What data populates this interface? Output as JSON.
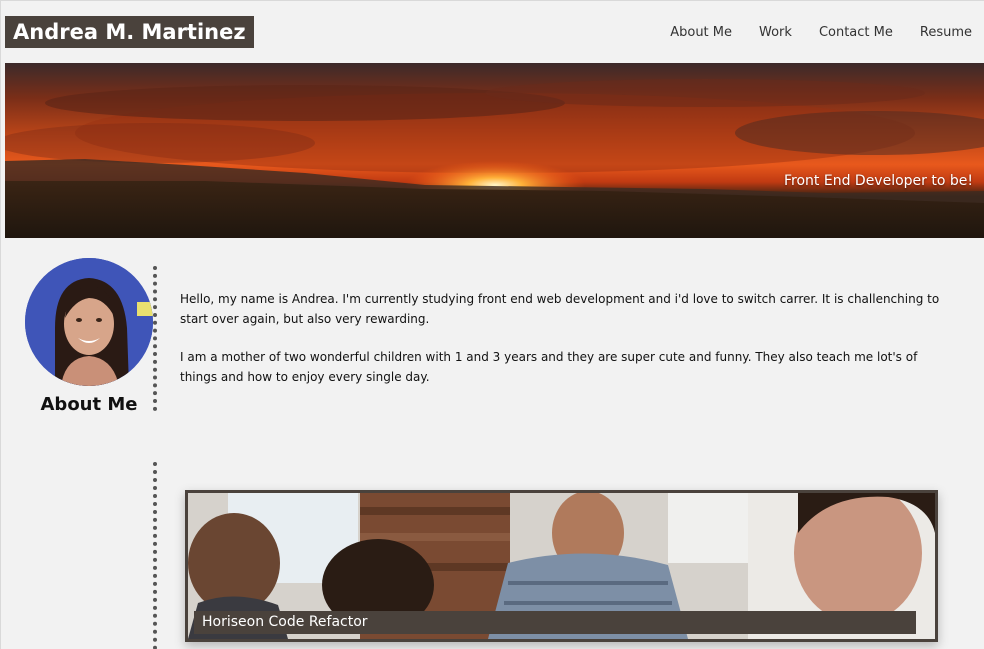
{
  "header": {
    "title": "Andrea M. Martinez",
    "nav": [
      "About Me",
      "Work",
      "Contact Me",
      "Resume"
    ]
  },
  "hero": {
    "tagline": "Front End Developer to be!",
    "image": "sunset-landscape"
  },
  "about": {
    "heading": "About Me",
    "avatar": "profile-photo",
    "paragraphs": [
      "Hello, my name is Andrea. I'm currently studying front end web development and i'd love to switch carrer. It is challenching to start over again, but also very rewarding.",
      "I am a mother of two wonderful children with 1 and 3 years and they are super cute and funny. They also teach me lot's of things and how to enjoy every single day."
    ]
  },
  "work": {
    "projects": [
      {
        "title": "Horiseon Code Refactor",
        "image": "team-meeting-photo"
      }
    ]
  },
  "colors": {
    "header_bg": "#4a423c",
    "page_bg": "#f2f2f2",
    "text": "#111111"
  }
}
